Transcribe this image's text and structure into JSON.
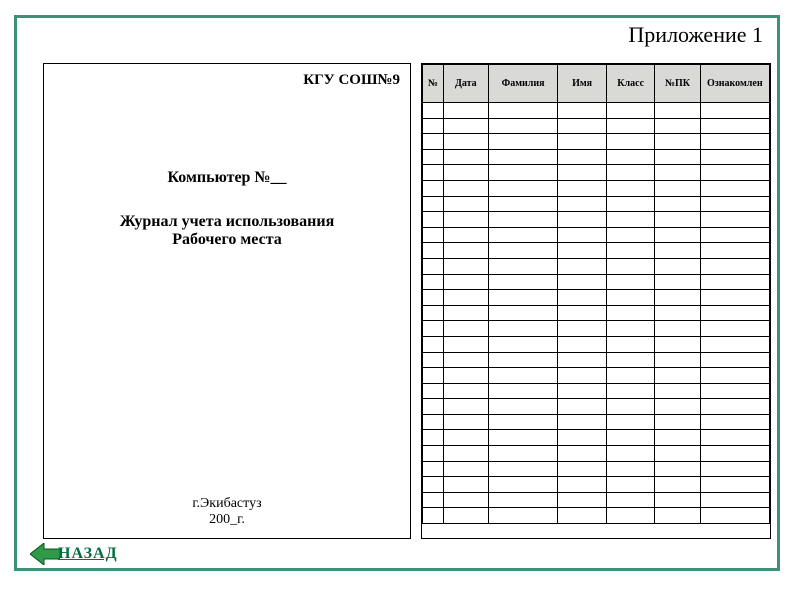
{
  "appendix_title": "Приложение 1",
  "left": {
    "school": "КГУ СОШ№9",
    "computer_line": "Компьютер №__",
    "journal_line1": "Журнал учета использования",
    "journal_line2": "Рабочего места",
    "city": "г.Экибастуз",
    "year": "200_г."
  },
  "table": {
    "headers": {
      "num": "№",
      "date": "Дата",
      "surname": "Фамилия",
      "name": "Имя",
      "class": "Класс",
      "pk": "№ПК",
      "ack": "Ознакомлен"
    },
    "row_count": 27
  },
  "nav": {
    "back": "НАЗАД"
  }
}
